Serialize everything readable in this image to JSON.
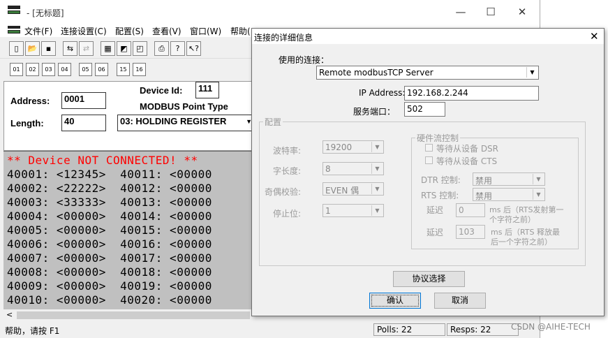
{
  "main_window": {
    "title": "- [无标题]",
    "controls": {
      "minimize": "—",
      "maximize": "☐",
      "close": "✕"
    },
    "menu": [
      "文件(F)",
      "连接设置(C)",
      "配置(S)",
      "查看(V)",
      "窗口(W)",
      "帮助("
    ],
    "toolbar1_icons": [
      "new-icon",
      "open-icon",
      "save-icon",
      "connect-icon",
      "disconnect-icon",
      "scan-icon",
      "monitor-icon",
      "window-icon",
      "print-icon",
      "help-icon",
      "context-help-icon"
    ],
    "toolbar2_labels": [
      "01",
      "02",
      "03",
      "04",
      "05",
      "06",
      "15",
      "16"
    ],
    "form": {
      "address_label": "Address:",
      "address_value": "0001",
      "device_id_label": "Device Id:",
      "device_id_value": "111",
      "point_type_label": "MODBUS Point Type",
      "length_label": "Length:",
      "length_value": "40",
      "point_type_value": "03: HOLDING REGISTER"
    },
    "registers": {
      "status": "** Device NOT CONNECTED! **",
      "rows": [
        "40001: <12345>  40011: <00000",
        "40002: <22222>  40012: <00000",
        "40003: <33333>  40013: <00000",
        "40004: <00000>  40014: <00000",
        "40005: <00000>  40015: <00000",
        "40006: <00000>  40016: <00000",
        "40007: <00000>  40017: <00000",
        "40008: <00000>  40018: <00000",
        "40009: <00000>  40019: <00000",
        "40010: <00000>  40020: <00000"
      ]
    },
    "status_bar": {
      "help": "帮助，请按 F1",
      "polls": "Polls: 22",
      "resps": "Resps: 22"
    }
  },
  "dialog": {
    "title": "连接的详细信息",
    "close": "✕",
    "connection_label": "使用的连接：",
    "connection_value": "Remote modbusTCP Server",
    "ip_label": "IP Address:",
    "ip_value": "192.168.2.244",
    "port_label": "服务端口：",
    "port_value": "502",
    "config_group": "配置",
    "baud_label": "波特率:",
    "baud_value": "19200",
    "databits_label": "字长度:",
    "databits_value": "8",
    "parity_label": "奇偶校验:",
    "parity_value": "EVEN 偶",
    "stopbits_label": "停止位:",
    "stopbits_value": "1",
    "flow_group": "硬件流控制",
    "wait_dsr": "等待从设备 DSR",
    "wait_cts": "等待从设备 CTS",
    "dtr_label": "DTR 控制:",
    "dtr_value": "禁用",
    "rts_label": "RTS 控制:",
    "rts_value": "禁用",
    "delay1_label": "延迟",
    "delay1_value": "0",
    "delay1_note_1": "ms 后（RTS发射第一",
    "delay1_note_2": "个字符之前）",
    "delay2_label": "延迟",
    "delay2_value": "103",
    "delay2_note_1": "ms 后（RTS 释放最",
    "delay2_note_2": "后一个字符之前）",
    "protocol_button": "协议选择",
    "ok_button": "确认",
    "cancel_button": "取消"
  },
  "watermark": "CSDN @AIHE-TECH",
  "colors": {
    "status_red": "#ff0000",
    "register_bg": "#c0c0c0"
  }
}
